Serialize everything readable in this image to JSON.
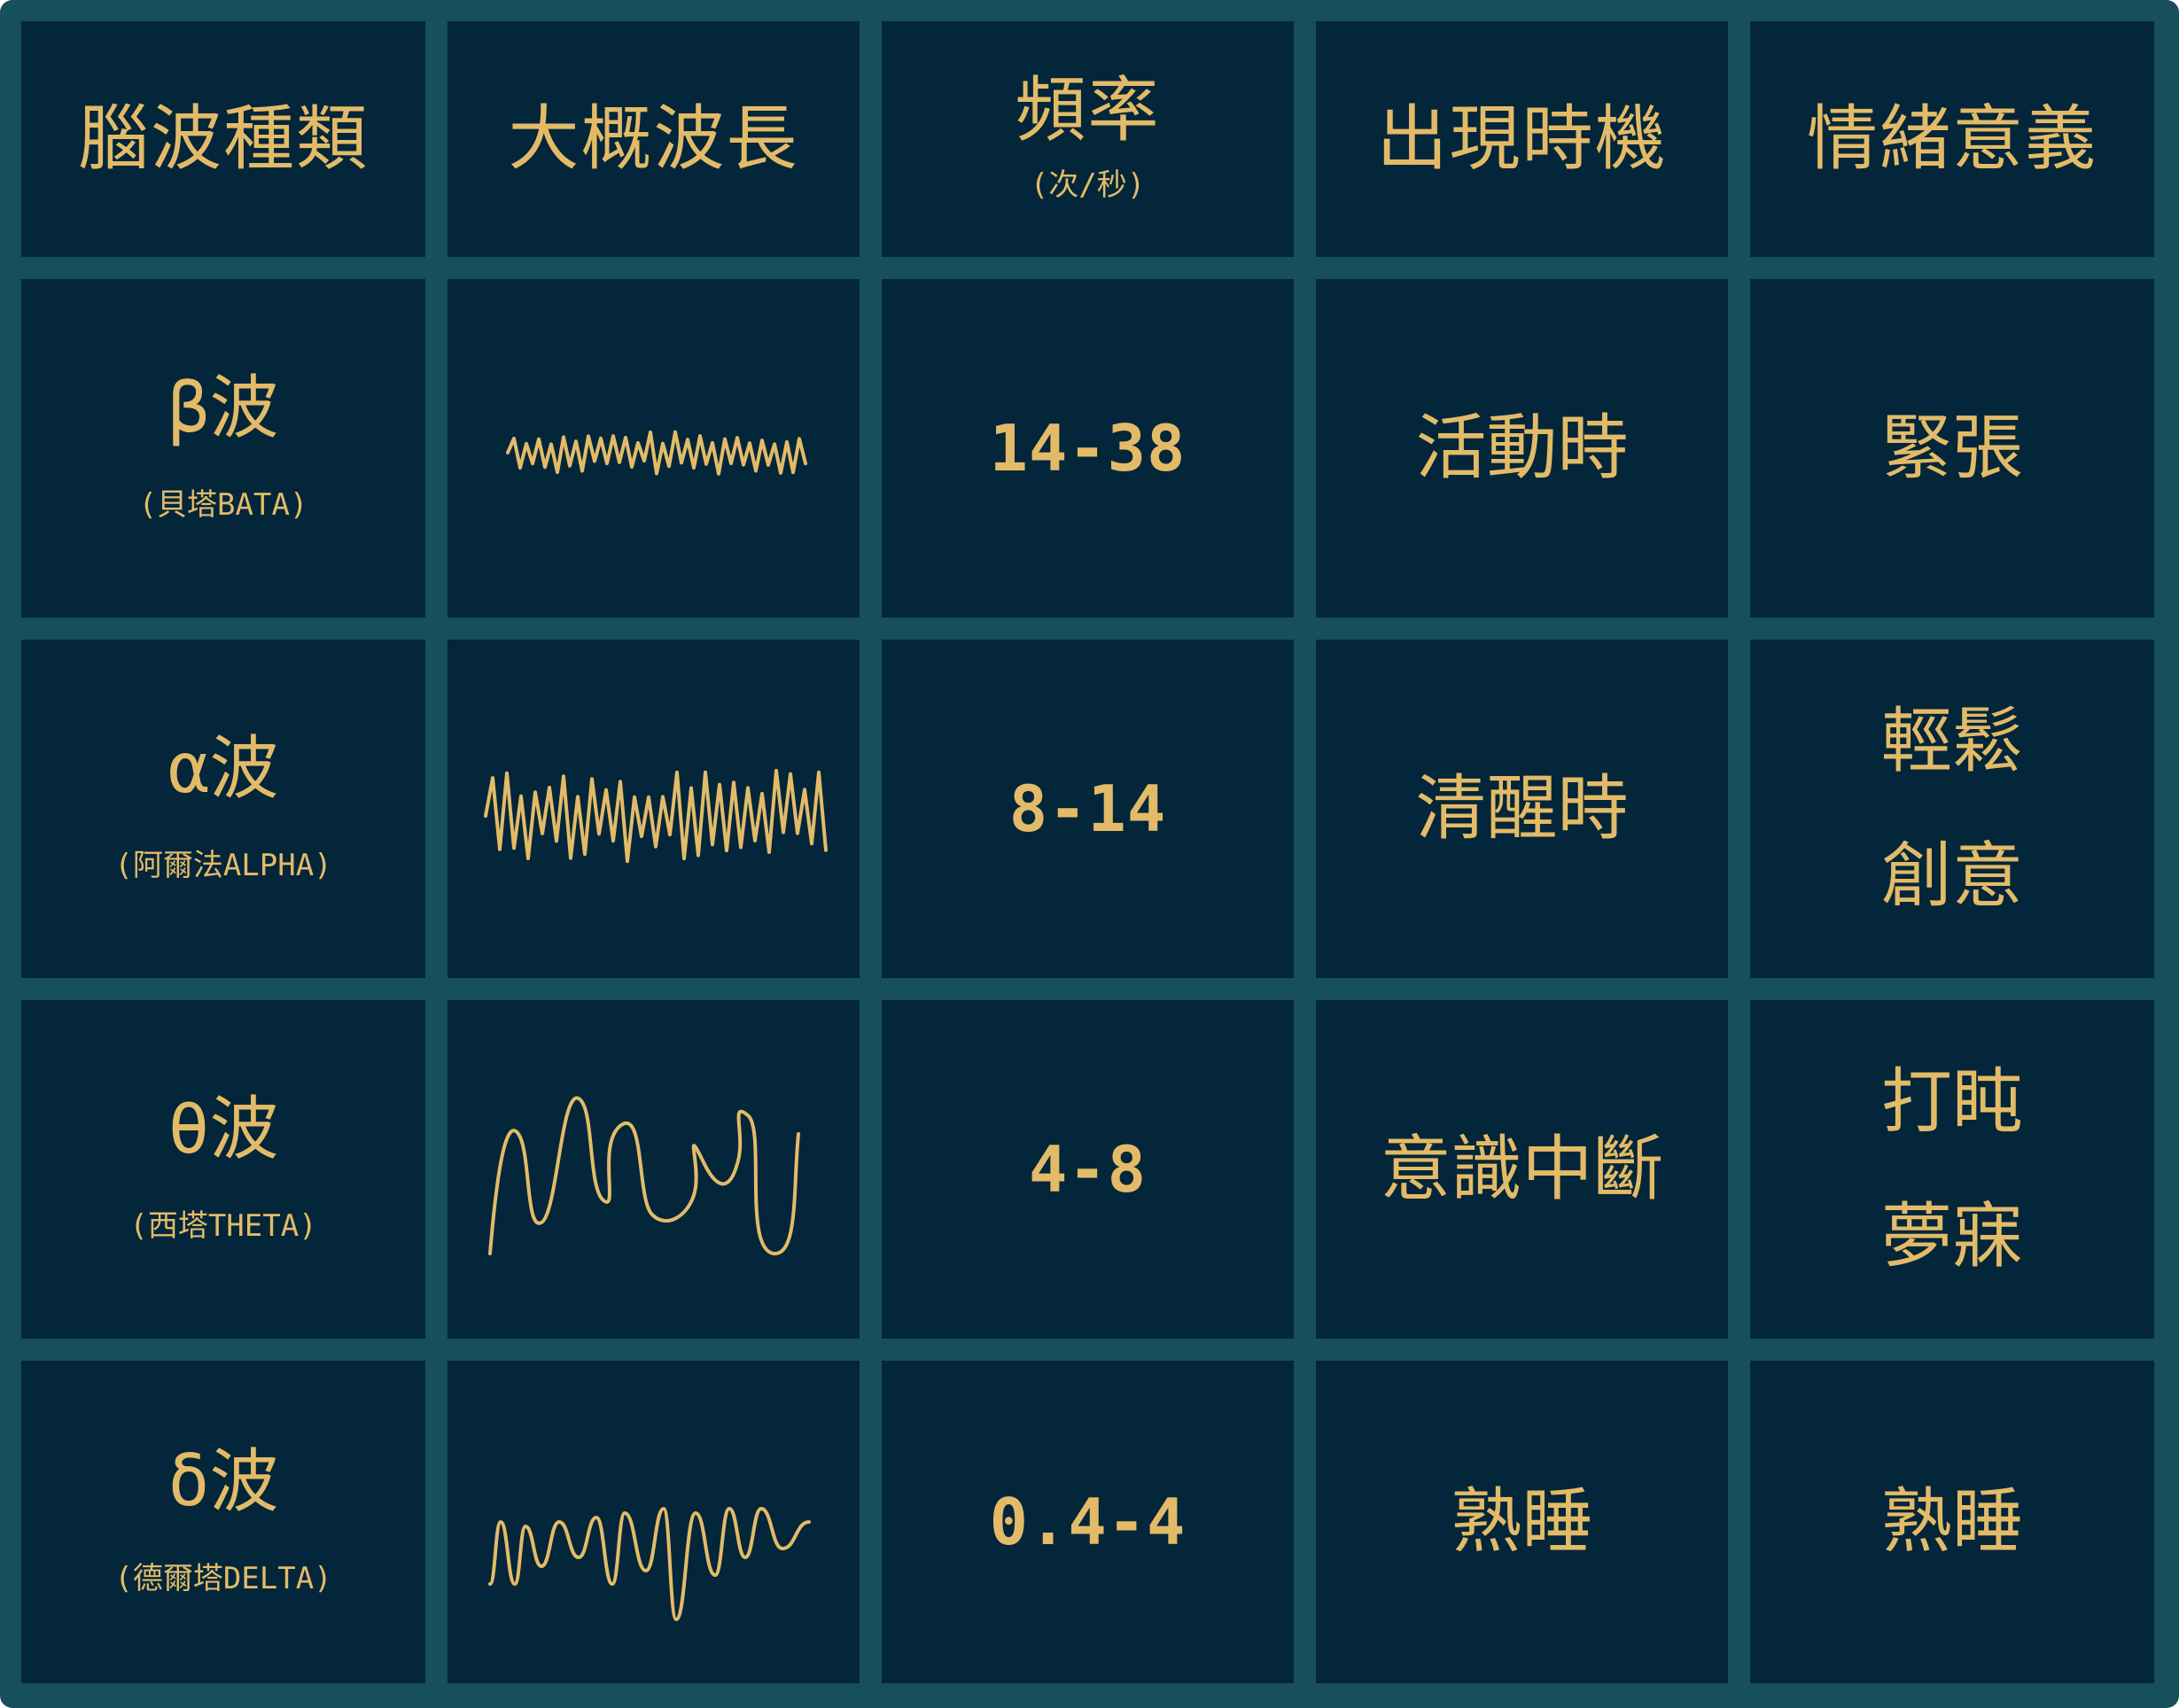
{
  "headers": {
    "type": "腦波種類",
    "wavelength": "大概波長",
    "frequency": "頻率",
    "frequency_unit": "(次/秒)",
    "timing": "出現時機",
    "emotion": "情緒意義"
  },
  "rows": [
    {
      "symbol": "β波",
      "name": "(貝塔BATA)",
      "wave_style": "fast-jagged",
      "frequency": "14-38",
      "timing": "活動時",
      "emotion_line1": "緊張",
      "emotion_line2": ""
    },
    {
      "symbol": "α波",
      "name": "(阿爾法ALPHA)",
      "wave_style": "spiky-irregular",
      "frequency": "8-14",
      "timing": "清醒時",
      "emotion_line1": "輕鬆",
      "emotion_line2": "創意"
    },
    {
      "symbol": "θ波",
      "name": "(西塔THETA)",
      "wave_style": "slow-loops",
      "frequency": "4-8",
      "timing": "意識中斷",
      "emotion_line1": "打盹",
      "emotion_line2": "夢寐"
    },
    {
      "symbol": "δ波",
      "name": "(德爾塔DELTA)",
      "wave_style": "slow-arches",
      "frequency": "0.4-4",
      "timing": "熟睡",
      "emotion_line1": "熟睡",
      "emotion_line2": ""
    }
  ],
  "colors": {
    "frame": "#174f5c",
    "cell": "#03263a",
    "text": "#e3bb68"
  }
}
